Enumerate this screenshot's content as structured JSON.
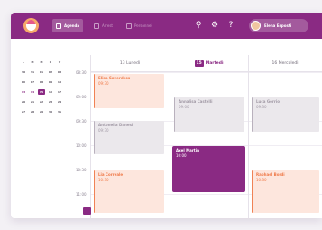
{
  "nav": {
    "items": [
      {
        "label": "Agenda",
        "active": true
      },
      {
        "label": "Arrest",
        "active": false
      },
      {
        "label": "Personnel",
        "active": false
      }
    ],
    "search_icon": "search-icon",
    "settings_icon": "gear-icon",
    "help_label": "?",
    "user_name": "Elena Esposti"
  },
  "mini_calendar": {
    "rows": [
      [
        "L",
        "M",
        "M",
        "G",
        "V"
      ],
      [
        "30",
        "31",
        "01",
        "02",
        "03"
      ],
      [
        "06",
        "07",
        "08",
        "09",
        "10"
      ],
      [
        "13",
        "14",
        "15",
        "16",
        "17"
      ],
      [
        "20",
        "21",
        "22",
        "23",
        "24"
      ],
      [
        "27",
        "28",
        "29",
        "30",
        "31"
      ]
    ],
    "selected": "15"
  },
  "times": [
    "08:30",
    "09:00",
    "09:30",
    "10:00",
    "10:30",
    "11:00"
  ],
  "days": [
    {
      "number": "",
      "label": "13 Lunedì",
      "today": false
    },
    {
      "number": "15",
      "label": "Martedì",
      "today": true
    },
    {
      "number": "",
      "label": "16 Mercoledì",
      "today": false
    }
  ],
  "events": [
    {
      "name": "Elisa Saverdess",
      "time": "09:30",
      "style": "peach"
    },
    {
      "name": "Antonella Danesi",
      "time": "09:30",
      "style": "grey"
    },
    {
      "name": "Lia Correale",
      "time": "10:30",
      "style": "peach"
    },
    {
      "name": "Annalisa Castelli",
      "time": "09:00",
      "style": "grey"
    },
    {
      "name": "Axel Martin",
      "time": "10:00",
      "style": "purple"
    },
    {
      "name": "Luca Gorrio",
      "time": "09:30",
      "style": "grey"
    },
    {
      "name": "Raphael Bordi",
      "time": "10:30",
      "style": "peach"
    }
  ],
  "pager": {
    "label": "‹"
  },
  "colors": {
    "brand": "#8a2a83",
    "accent_peach": "#f08255",
    "neutral": "#ebe8ec"
  }
}
